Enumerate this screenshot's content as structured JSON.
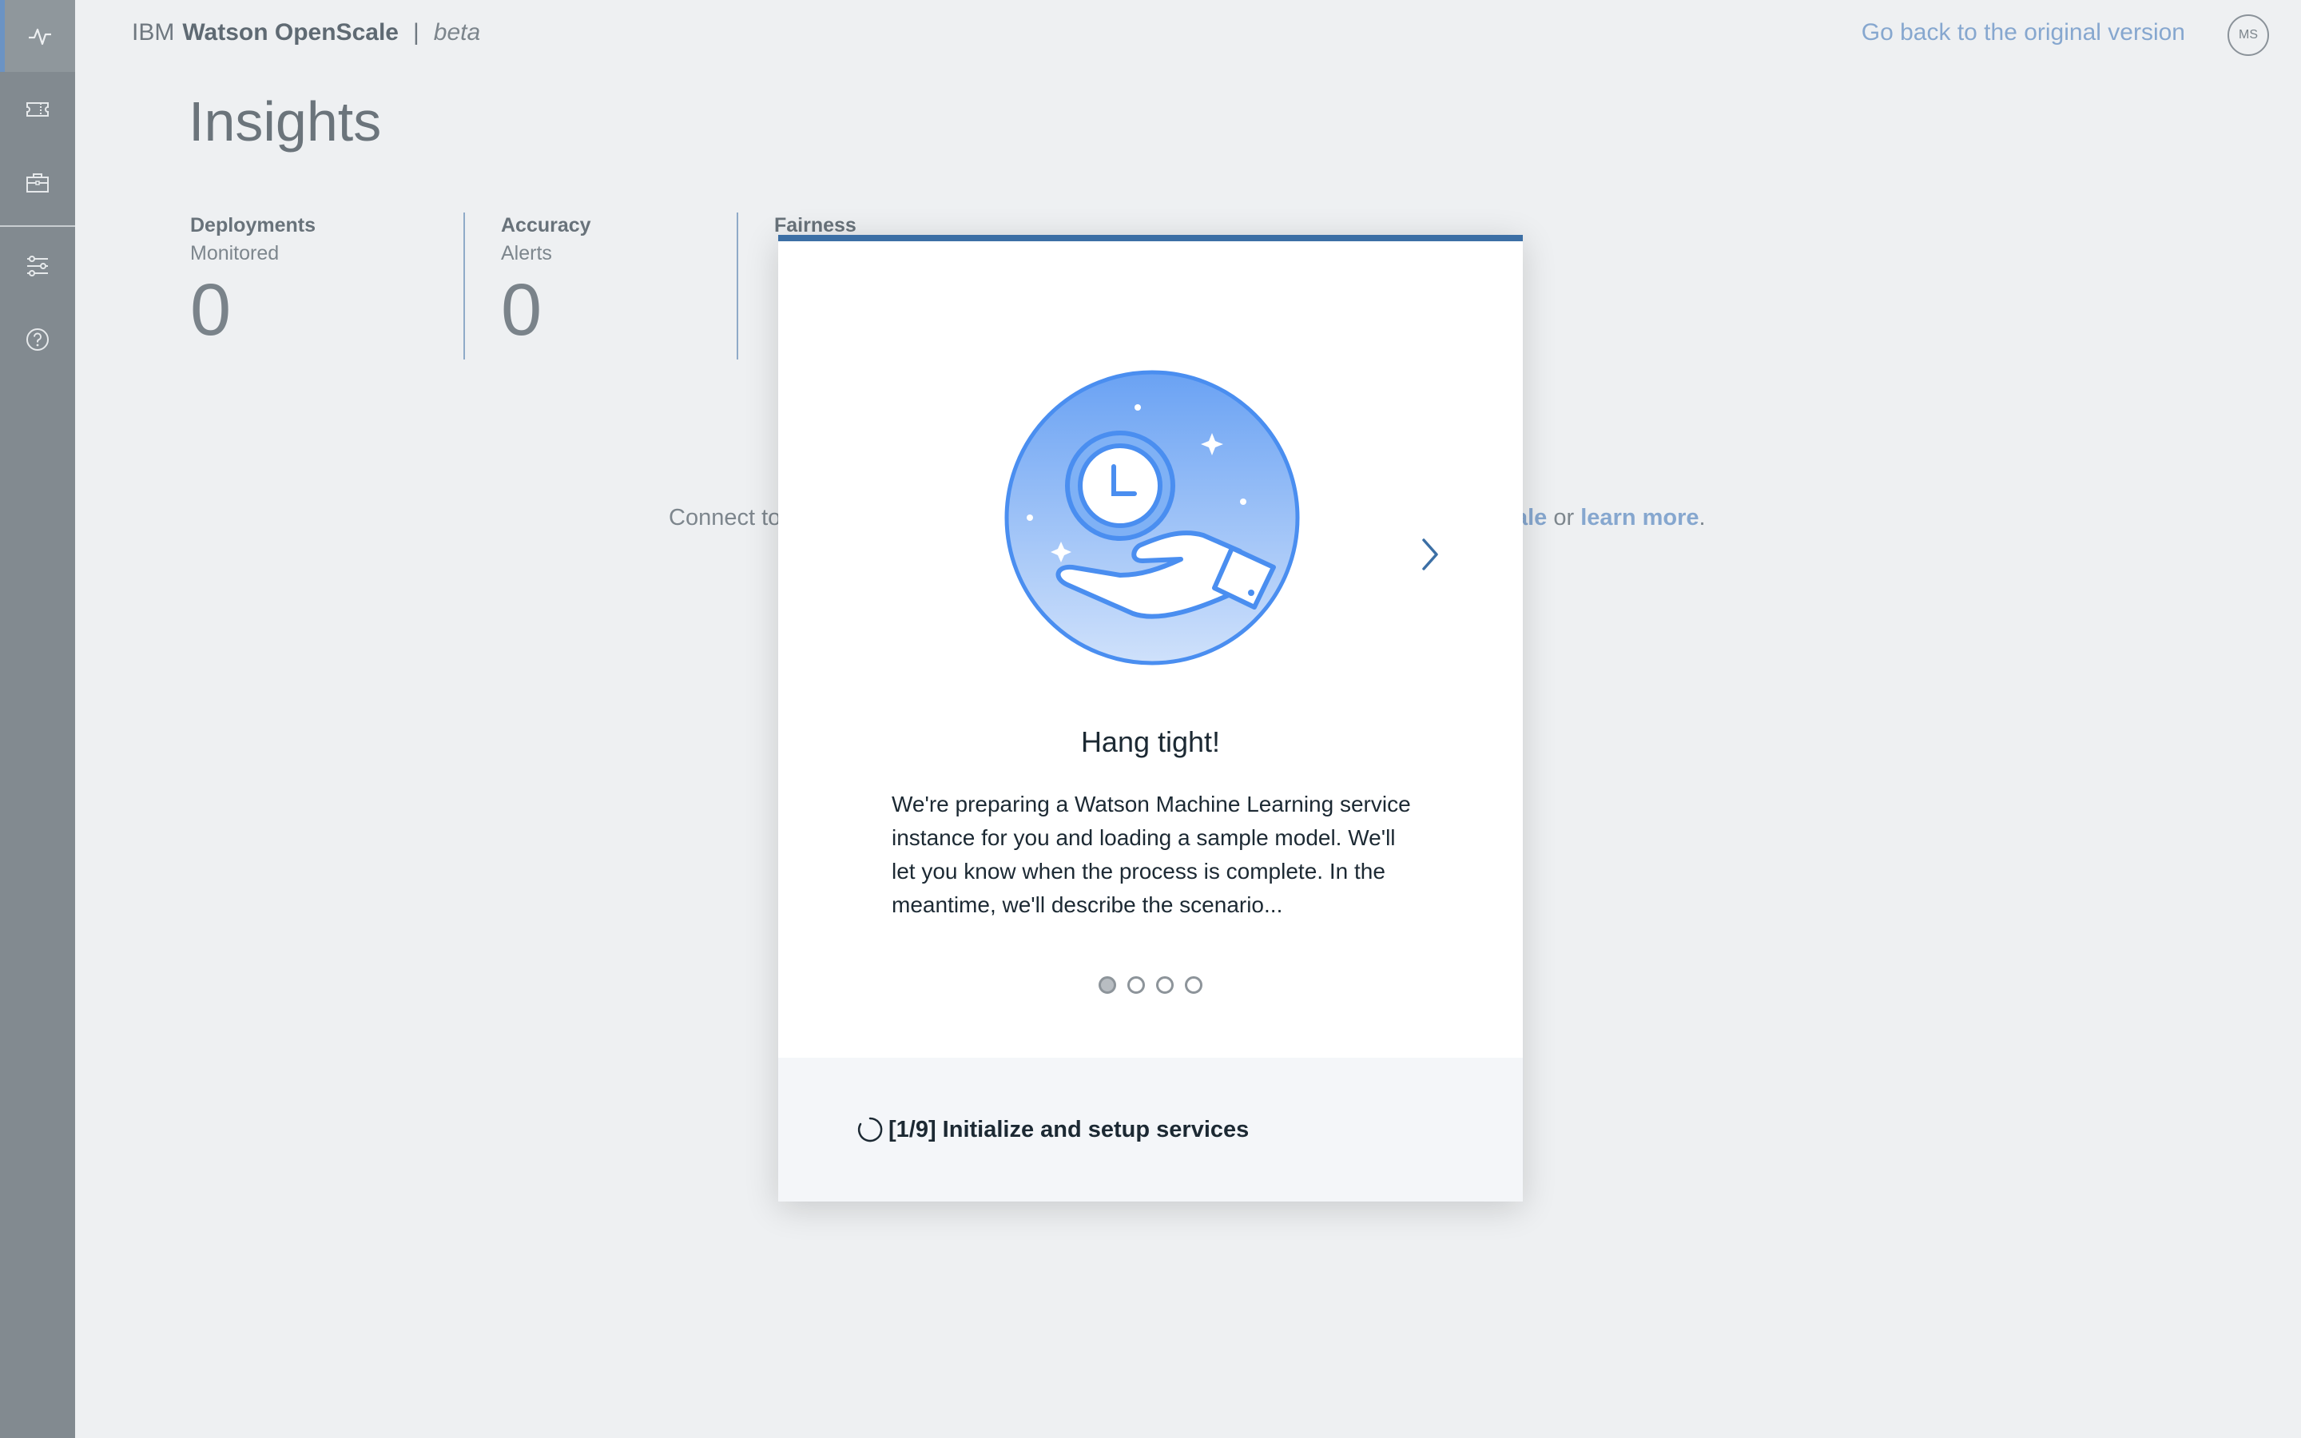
{
  "header": {
    "brand_prefix": "IBM",
    "brand_product": "Watson OpenScale",
    "brand_separator": "|",
    "brand_beta": "beta",
    "back_link": "Go back to the original version",
    "avatar_initials": "MS"
  },
  "sidebar": {
    "items": [
      {
        "icon": "activity-icon",
        "active": true
      },
      {
        "icon": "ticket-icon",
        "active": false
      },
      {
        "icon": "briefcase-icon",
        "active": false
      },
      {
        "icon": "sliders-icon",
        "active": false
      },
      {
        "icon": "help-icon",
        "active": false
      }
    ],
    "accent_color": "#6b93c4"
  },
  "page": {
    "title": "Insights",
    "stats": [
      {
        "label": "Deployments",
        "sub": "Monitored",
        "value": "0"
      },
      {
        "label": "Accuracy",
        "sub": "Alerts",
        "value": "0"
      },
      {
        "label": "Fairness",
        "sub": "",
        "value": ""
      }
    ],
    "background_text": {
      "left": "Connect to",
      "right_link_fragment": "ale",
      "or": "or",
      "learn_more": "learn more",
      "period": "."
    }
  },
  "modal": {
    "title": "Hang tight!",
    "body": "We're preparing a Watson Machine Learning service instance for you and loading a sample model. We'll let you know when the process is complete. In the meantime, we'll describe the scenario...",
    "pagination": {
      "current": 1,
      "total": 4
    },
    "status": "[1/9] Initialize and setup services",
    "progress_color": "#3c6fa5"
  }
}
